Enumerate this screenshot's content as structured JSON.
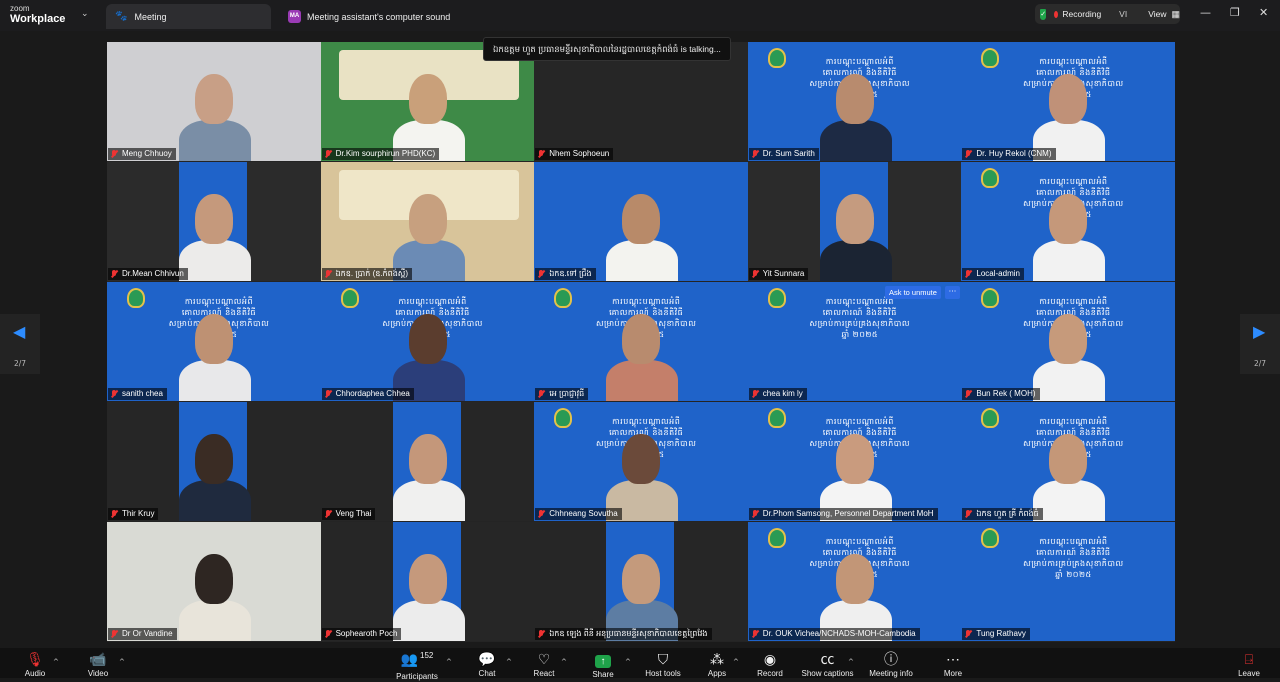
{
  "app": {
    "logo_line1": "zoom",
    "logo_line2": "Workplace"
  },
  "tabs": [
    {
      "label": "Meeting"
    },
    {
      "label": "Meeting assistant's computer sound",
      "badge": "MA"
    }
  ],
  "header": {
    "recording": "Recording",
    "language": "VI",
    "view": "View"
  },
  "colors": {
    "banner_blue": "#1f63c9",
    "muted_red": "#e33333",
    "share_green": "#1fa34a",
    "accent_blue": "#2d8cff"
  },
  "talking_indicator": {
    "name": "ឯកឧត្តម ហួត ប្រធានមន្ទីរសុខាភិបាលនៃរដ្ឋបាលខេត្តកំពង់ធំ",
    "suffix": "is talking..."
  },
  "popup": {
    "ask_unmute": "Ask to unmute",
    "more": "···"
  },
  "pager": {
    "left_label": "2/7",
    "right_label": "2/7"
  },
  "banner": {
    "line1": "ការបណ្តុះបណ្តាលអំពី",
    "line2": "គោលការណ៍ និងនីតិវិធី",
    "line3": "សម្រាប់ការគ្រប់គ្រងសុខាភិបាល",
    "line4": "ឆ្នាំ ២០២៥"
  },
  "participants": [
    {
      "name": "Meng Chhuoy"
    },
    {
      "name": "Dr.Kim sourphirun PHD(KC)"
    },
    {
      "name": "Nhem Sophoeun"
    },
    {
      "name": "Dr. Sum Sarith"
    },
    {
      "name": "Dr. Huy Rekol (CNM)"
    },
    {
      "name": "Dr.Mean Chhivun"
    },
    {
      "name": "ឯកឧ. ប្រាក់ (ឧ.កំពង់ស្ពឺ)"
    },
    {
      "name": "ឯកឧ.ទៅ ជ្រឹង"
    },
    {
      "name": "Yit Sunnara"
    },
    {
      "name": "Local-admin"
    },
    {
      "name": "sanith chea"
    },
    {
      "name": "Chhordaphea Chhea"
    },
    {
      "name": "អេ ប្រាជ្ញាវុធី"
    },
    {
      "name": "chea kim ly"
    },
    {
      "name": "Bun Rek ( MOH)"
    },
    {
      "name": "Thir Kruy"
    },
    {
      "name": "Veng Thai"
    },
    {
      "name": "Chhneang Sovutha"
    },
    {
      "name": "Dr.Phom Samsong, Personnel Department MoH"
    },
    {
      "name": "ឯកឧ ហួត គ្រី កំពង់ធំ"
    },
    {
      "name": "Dr Or Vandine"
    },
    {
      "name": "Sophearoth Poch"
    },
    {
      "name": "ឯកឧ ឡេង ពីនី អនុប្រធានមន្ទីរសុខាភិបាលខេត្តព្រៃវែង"
    },
    {
      "name": "Dr. OUK Vichea/NCHADS-MOH-Cambodia"
    },
    {
      "name": "Tung Rathavy"
    }
  ],
  "toolbar": {
    "audio": "Audio",
    "video": "Video",
    "participants": "Participants",
    "participant_count": "152",
    "chat": "Chat",
    "react": "React",
    "share": "Share",
    "host_tools": "Host tools",
    "apps": "Apps",
    "record": "Record",
    "show_captions": "Show captions",
    "meeting_info": "Meeting info",
    "more": "More",
    "leave": "Leave"
  }
}
